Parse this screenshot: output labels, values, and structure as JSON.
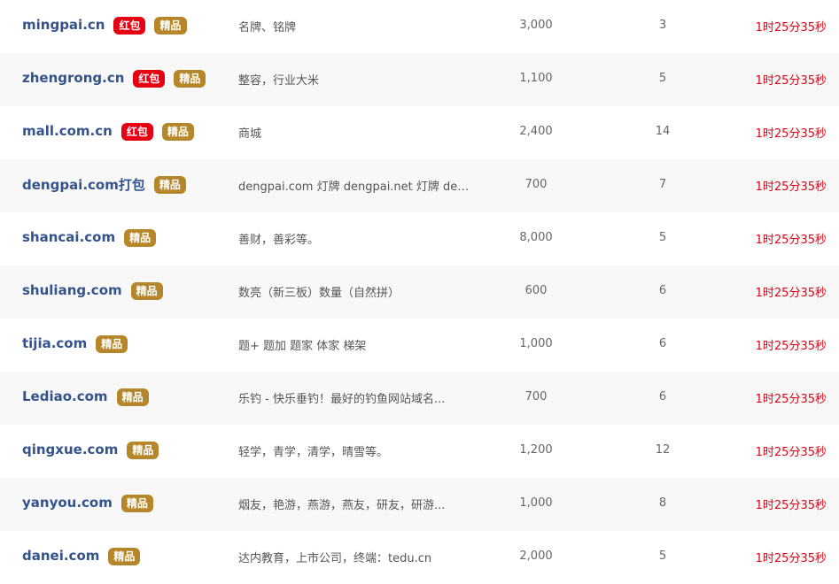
{
  "colors": {
    "domain_link": "#34538b",
    "badge_red": "#e60012",
    "badge_gold": "#b5862a",
    "countdown": "#e60012",
    "row_alt_bg": "#f8f8f8"
  },
  "rows": [
    {
      "domain": "mingpai.cn",
      "badges": [
        {
          "text": "红包",
          "type": "red"
        },
        {
          "text": "精品",
          "type": "gold"
        }
      ],
      "description": "名牌、铭牌",
      "price": "3,000",
      "count": "3",
      "time_left": "1时25分35秒"
    },
    {
      "domain": "zhengrong.cn",
      "badges": [
        {
          "text": "红包",
          "type": "red"
        },
        {
          "text": "精品",
          "type": "gold"
        }
      ],
      "description": "整容，行业大米",
      "price": "1,100",
      "count": "5",
      "time_left": "1时25分35秒"
    },
    {
      "domain": "mall.com.cn",
      "badges": [
        {
          "text": "红包",
          "type": "red"
        },
        {
          "text": "精品",
          "type": "gold"
        }
      ],
      "description": "商城",
      "price": "2,400",
      "count": "14",
      "time_left": "1时25分35秒"
    },
    {
      "domain": "dengpai.com打包",
      "badges": [
        {
          "text": "精品",
          "type": "gold"
        }
      ],
      "description": "dengpai.com 灯牌 dengpai.net 灯牌 den...",
      "price": "700",
      "count": "7",
      "time_left": "1时25分35秒"
    },
    {
      "domain": "shancai.com",
      "badges": [
        {
          "text": "精品",
          "type": "gold"
        }
      ],
      "description": "善财，善彩等。",
      "price": "8,000",
      "count": "5",
      "time_left": "1时25分35秒"
    },
    {
      "domain": "shuliang.com",
      "badges": [
        {
          "text": "精品",
          "type": "gold"
        }
      ],
      "description": "数亮（新三板）数量（自然拼）",
      "price": "600",
      "count": "6",
      "time_left": "1时25分35秒"
    },
    {
      "domain": "tijia.com",
      "badges": [
        {
          "text": "精品",
          "type": "gold"
        }
      ],
      "description": "题+ 题加 题家 体家 梯架",
      "price": "1,000",
      "count": "6",
      "time_left": "1时25分35秒"
    },
    {
      "domain": "Lediao.com",
      "badges": [
        {
          "text": "精品",
          "type": "gold"
        }
      ],
      "description": "乐钓 - 快乐垂钓！最好的钓鱼网站域名...",
      "price": "700",
      "count": "6",
      "time_left": "1时25分35秒"
    },
    {
      "domain": "qingxue.com",
      "badges": [
        {
          "text": "精品",
          "type": "gold"
        }
      ],
      "description": "轻学，青学，清学，晴雪等。",
      "price": "1,200",
      "count": "12",
      "time_left": "1时25分35秒"
    },
    {
      "domain": "yanyou.com",
      "badges": [
        {
          "text": "精品",
          "type": "gold"
        }
      ],
      "description": "烟友，艳游，燕游，燕友，研友，研游...",
      "price": "1,000",
      "count": "8",
      "time_left": "1时25分35秒"
    },
    {
      "domain": "danei.com",
      "badges": [
        {
          "text": "精品",
          "type": "gold"
        }
      ],
      "description": "达内教育，上市公司，终端：tedu.cn",
      "price": "2,000",
      "count": "5",
      "time_left": "1时25分35秒"
    }
  ]
}
